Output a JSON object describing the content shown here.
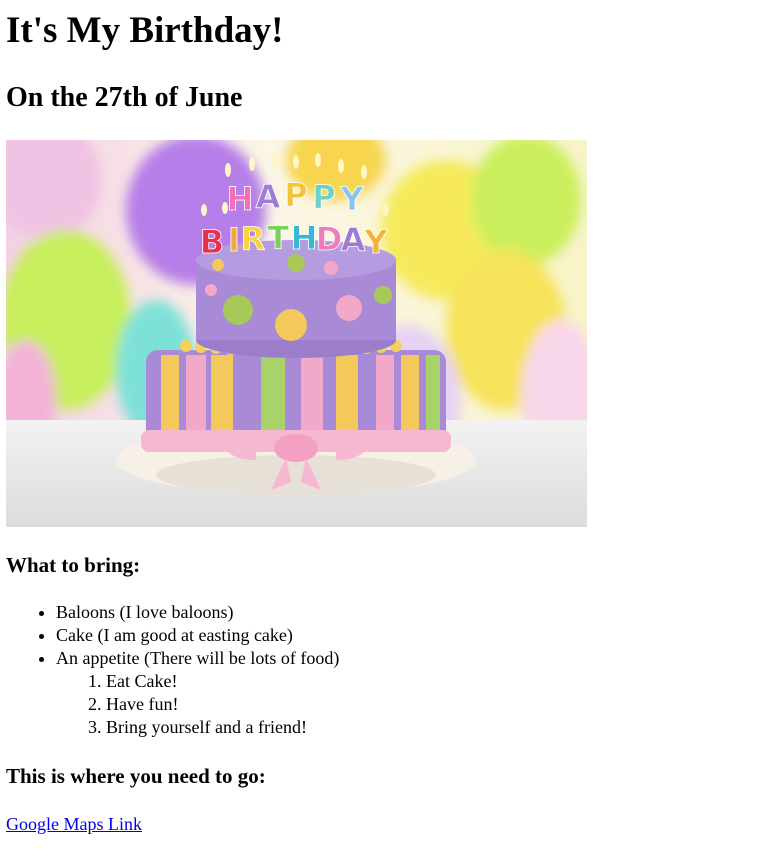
{
  "heading": "It's My Birthday!",
  "subheading": "On the 27th of June",
  "hero_image": {
    "alt": "",
    "candle_letters_top": [
      "H",
      "A",
      "P",
      "P",
      "Y"
    ],
    "candle_letters_bottom": [
      "B",
      "I",
      "R",
      "T",
      "H",
      "D",
      "A",
      "Y"
    ]
  },
  "bring_heading": "What to bring:",
  "bring_items": [
    "Baloons (I love baloons)",
    "Cake (I am good at easting cake)",
    "An appetite (There will be lots of food)"
  ],
  "todo_items": [
    "Eat Cake!",
    "Have fun!",
    "Bring yourself and a friend!"
  ],
  "go_heading": "This is where you need to go:",
  "maps_link": "Google Maps Link",
  "colors": {
    "link": "#0000ee",
    "cake_purple": "#a98ad6",
    "cake_pink": "#f2a9c9",
    "balloon_green": "#c9ef5a",
    "balloon_yellow": "#f7e35a"
  }
}
